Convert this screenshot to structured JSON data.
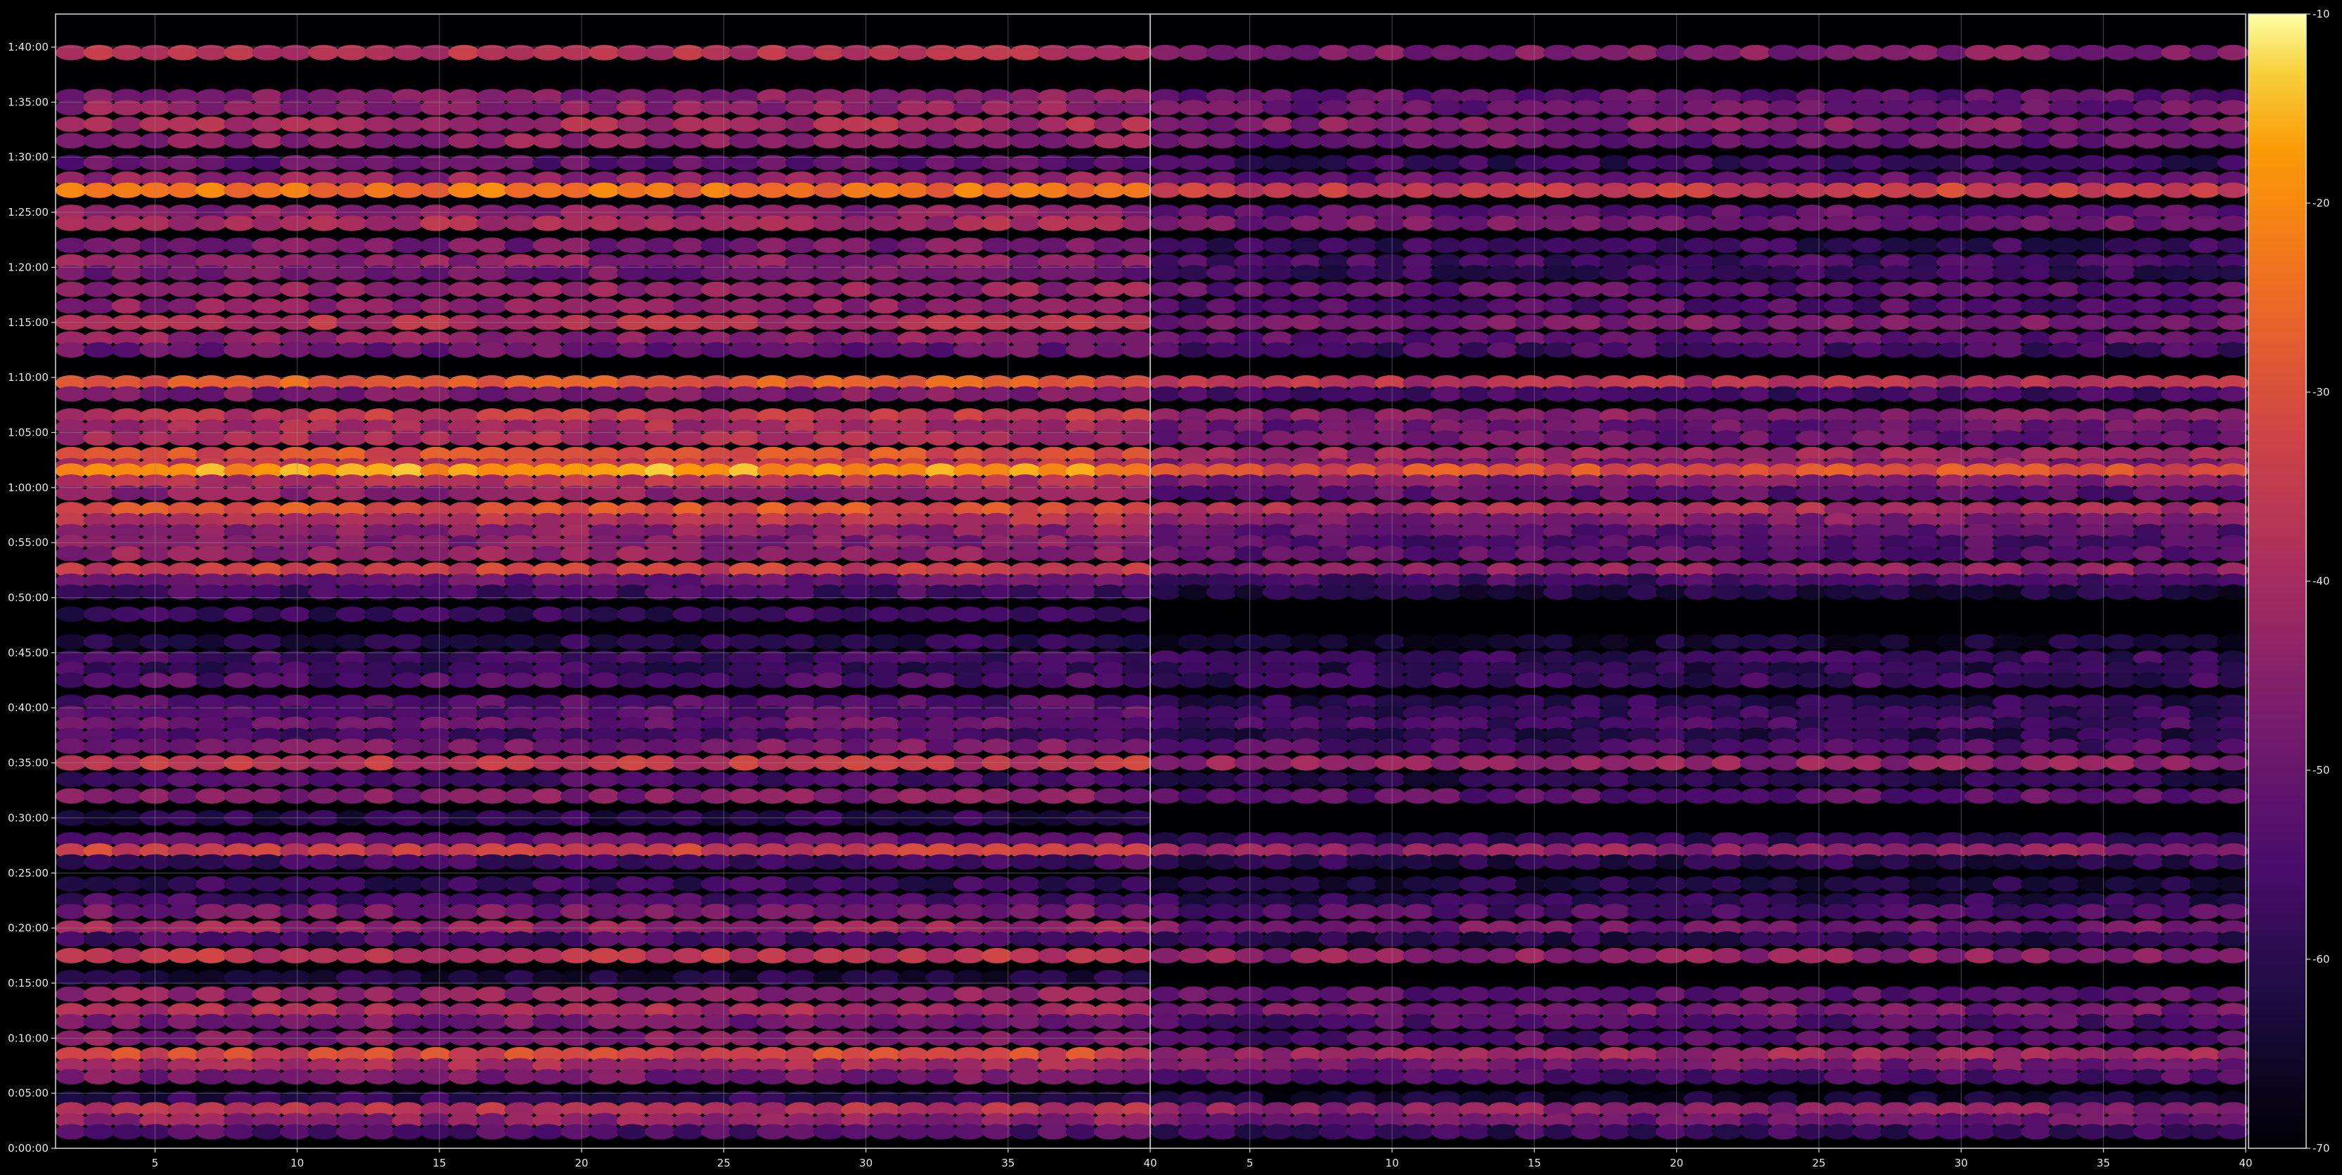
{
  "chart_data": {
    "type": "heatmap",
    "title": "",
    "xlabel": "",
    "ylabel": "",
    "grid": true,
    "colormap": "inferno",
    "panels": [
      {
        "name": "",
        "x_ticks": [
          "5",
          "10",
          "15",
          "20",
          "25",
          "30",
          "35",
          "40"
        ],
        "xlim": [
          1.5,
          40
        ],
        "y_ticks": [
          "0:00:00",
          "0:05:00",
          "0:10:00",
          "0:15:00",
          "0:20:00",
          "0:25:00",
          "0:30:00",
          "0:35:00",
          "0:40:00",
          "0:45:00",
          "0:50:00",
          "0:55:00",
          "1:00:00",
          "1:05:00",
          "1:10:00",
          "1:15:00",
          "1:20:00",
          "1:25:00",
          "1:30:00",
          "1:35:00",
          "1:40:00"
        ],
        "ylim": [
          "0:00:00",
          "1:43:00"
        ],
        "band_rows": [
          {
            "t": "1:39:30",
            "level": -37
          },
          {
            "t": "1:35:30",
            "level": -46
          },
          {
            "t": "1:34:30",
            "level": -44
          },
          {
            "t": "1:33:00",
            "level": -40
          },
          {
            "t": "1:31:30",
            "level": -44
          },
          {
            "t": "1:29:30",
            "level": -52
          },
          {
            "t": "1:28:00",
            "level": -44
          },
          {
            "t": "1:27:00",
            "level": -24
          },
          {
            "t": "1:25:00",
            "level": -45
          },
          {
            "t": "1:24:00",
            "level": -40
          },
          {
            "t": "1:22:00",
            "level": -48
          },
          {
            "t": "1:20:30",
            "level": -44
          },
          {
            "t": "1:19:30",
            "level": -49
          },
          {
            "t": "1:18:00",
            "level": -43
          },
          {
            "t": "1:16:30",
            "level": -45
          },
          {
            "t": "1:15:00",
            "level": -38
          },
          {
            "t": "1:13:30",
            "level": -44
          },
          {
            "t": "1:12:30",
            "level": -50
          },
          {
            "t": "1:09:30",
            "level": -28
          },
          {
            "t": "1:08:30",
            "level": -47
          },
          {
            "t": "1:06:30",
            "level": -36
          },
          {
            "t": "1:05:30",
            "level": -40
          },
          {
            "t": "1:04:30",
            "level": -40
          },
          {
            "t": "1:03:00",
            "level": -30
          },
          {
            "t": "1:02:00",
            "level": -36
          },
          {
            "t": "1:01:30",
            "level": -18
          },
          {
            "t": "1:00:30",
            "level": -38
          },
          {
            "t": "0:59:30",
            "level": -44
          },
          {
            "t": "0:58:00",
            "level": -30
          },
          {
            "t": "0:57:00",
            "level": -38
          },
          {
            "t": "0:56:00",
            "level": -44
          },
          {
            "t": "0:55:00",
            "level": -46
          },
          {
            "t": "0:54:00",
            "level": -44
          },
          {
            "t": "0:52:30",
            "level": -34
          },
          {
            "t": "0:51:30",
            "level": -50
          },
          {
            "t": "0:50:30",
            "level": -56
          },
          {
            "t": "0:48:30",
            "level": -58
          },
          {
            "t": "0:46:00",
            "level": -60
          },
          {
            "t": "0:44:30",
            "level": -56
          },
          {
            "t": "0:43:30",
            "level": -58
          },
          {
            "t": "0:42:30",
            "level": -54
          },
          {
            "t": "0:40:30",
            "level": -54
          },
          {
            "t": "0:39:30",
            "level": -54
          },
          {
            "t": "0:38:30",
            "level": -50
          },
          {
            "t": "0:37:30",
            "level": -56
          },
          {
            "t": "0:36:30",
            "level": -48
          },
          {
            "t": "0:35:00",
            "level": -36
          },
          {
            "t": "0:33:30",
            "level": -56
          },
          {
            "t": "0:32:00",
            "level": -46
          },
          {
            "t": "0:30:00",
            "level": -60
          },
          {
            "t": "0:28:00",
            "level": -52
          },
          {
            "t": "0:27:00",
            "level": -34
          },
          {
            "t": "0:26:00",
            "level": -56
          },
          {
            "t": "0:24:00",
            "level": -58
          },
          {
            "t": "0:22:30",
            "level": -56
          },
          {
            "t": "0:21:30",
            "level": -48
          },
          {
            "t": "0:20:00",
            "level": -42
          },
          {
            "t": "0:19:00",
            "level": -56
          },
          {
            "t": "0:17:30",
            "level": -36
          },
          {
            "t": "0:15:30",
            "level": -62
          },
          {
            "t": "0:14:00",
            "level": -44
          },
          {
            "t": "0:12:30",
            "level": -40
          },
          {
            "t": "0:11:30",
            "level": -48
          },
          {
            "t": "0:10:00",
            "level": -46
          },
          {
            "t": "0:08:30",
            "level": -32
          },
          {
            "t": "0:07:30",
            "level": -40
          },
          {
            "t": "0:06:30",
            "level": -48
          },
          {
            "t": "0:04:30",
            "level": -60
          },
          {
            "t": "0:03:30",
            "level": -38
          },
          {
            "t": "0:02:30",
            "level": -44
          },
          {
            "t": "0:01:30",
            "level": -54
          }
        ]
      },
      {
        "name": "",
        "x_ticks": [
          "5",
          "10",
          "15",
          "20",
          "25",
          "30",
          "35",
          "40"
        ],
        "xlim": [
          1.5,
          40
        ],
        "y_ticks": [],
        "ylim": [
          "0:00:00",
          "1:43:00"
        ],
        "band_rows": [
          {
            "t": "1:39:30",
            "level": -46
          },
          {
            "t": "1:35:30",
            "level": -52
          },
          {
            "t": "1:34:30",
            "level": -50
          },
          {
            "t": "1:33:00",
            "level": -46
          },
          {
            "t": "1:31:30",
            "level": -50
          },
          {
            "t": "1:29:30",
            "level": -58
          },
          {
            "t": "1:28:00",
            "level": -52
          },
          {
            "t": "1:27:00",
            "level": -34
          },
          {
            "t": "1:25:00",
            "level": -52
          },
          {
            "t": "1:24:00",
            "level": -48
          },
          {
            "t": "1:22:00",
            "level": -58
          },
          {
            "t": "1:20:30",
            "level": -56
          },
          {
            "t": "1:19:30",
            "level": -58
          },
          {
            "t": "1:18:00",
            "level": -52
          },
          {
            "t": "1:16:30",
            "level": -54
          },
          {
            "t": "1:15:00",
            "level": -48
          },
          {
            "t": "1:13:30",
            "level": -52
          },
          {
            "t": "1:12:30",
            "level": -56
          },
          {
            "t": "1:09:30",
            "level": -38
          },
          {
            "t": "1:08:30",
            "level": -56
          },
          {
            "t": "1:06:30",
            "level": -46
          },
          {
            "t": "1:05:30",
            "level": -50
          },
          {
            "t": "1:04:30",
            "level": -50
          },
          {
            "t": "1:03:00",
            "level": -42
          },
          {
            "t": "1:02:00",
            "level": -46
          },
          {
            "t": "1:01:30",
            "level": -30
          },
          {
            "t": "1:00:30",
            "level": -46
          },
          {
            "t": "0:59:30",
            "level": -52
          },
          {
            "t": "0:58:00",
            "level": -40
          },
          {
            "t": "0:57:00",
            "level": -46
          },
          {
            "t": "0:56:00",
            "level": -52
          },
          {
            "t": "0:55:00",
            "level": -54
          },
          {
            "t": "0:54:00",
            "level": -52
          },
          {
            "t": "0:52:30",
            "level": -44
          },
          {
            "t": "0:51:30",
            "level": -56
          },
          {
            "t": "0:50:30",
            "level": -62
          },
          {
            "t": "0:46:00",
            "level": -64
          },
          {
            "t": "0:44:30",
            "level": -58
          },
          {
            "t": "0:43:30",
            "level": -60
          },
          {
            "t": "0:42:30",
            "level": -58
          },
          {
            "t": "0:40:30",
            "level": -60
          },
          {
            "t": "0:39:30",
            "level": -58
          },
          {
            "t": "0:38:30",
            "level": -56
          },
          {
            "t": "0:37:30",
            "level": -60
          },
          {
            "t": "0:36:30",
            "level": -54
          },
          {
            "t": "0:35:00",
            "level": -44
          },
          {
            "t": "0:33:30",
            "level": -60
          },
          {
            "t": "0:32:00",
            "level": -52
          },
          {
            "t": "0:28:00",
            "level": -58
          },
          {
            "t": "0:27:00",
            "level": -44
          },
          {
            "t": "0:26:00",
            "level": -60
          },
          {
            "t": "0:24:00",
            "level": -62
          },
          {
            "t": "0:22:30",
            "level": -60
          },
          {
            "t": "0:21:30",
            "level": -54
          },
          {
            "t": "0:20:00",
            "level": -48
          },
          {
            "t": "0:19:00",
            "level": -60
          },
          {
            "t": "0:17:30",
            "level": -44
          },
          {
            "t": "0:14:00",
            "level": -52
          },
          {
            "t": "0:12:30",
            "level": -48
          },
          {
            "t": "0:11:30",
            "level": -54
          },
          {
            "t": "0:10:00",
            "level": -54
          },
          {
            "t": "0:08:30",
            "level": -42
          },
          {
            "t": "0:07:30",
            "level": -48
          },
          {
            "t": "0:06:30",
            "level": -54
          },
          {
            "t": "0:04:30",
            "level": -64
          },
          {
            "t": "0:03:30",
            "level": -44
          },
          {
            "t": "0:02:30",
            "level": -50
          },
          {
            "t": "0:01:30",
            "level": -58
          }
        ]
      }
    ],
    "colorbar": {
      "label": "",
      "ticks": [
        "-10",
        "-20",
        "-30",
        "-40",
        "-50",
        "-60",
        "-70"
      ],
      "range": [
        -70,
        -10
      ]
    }
  }
}
